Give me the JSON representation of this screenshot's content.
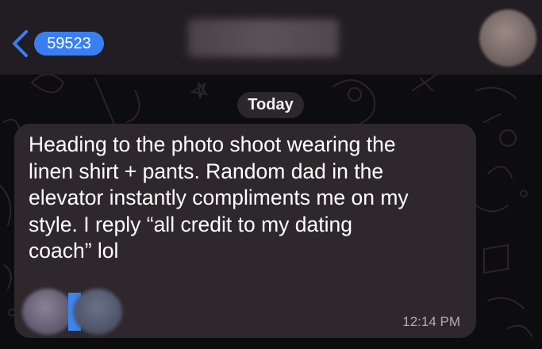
{
  "header": {
    "back_label": "Back",
    "unread_count": "59523",
    "colors": {
      "accent": "#3a7ff2",
      "bar": "#211d22"
    }
  },
  "chat": {
    "date_label": "Today",
    "message": {
      "text": "Heading to the photo shoot wearing the\nlinen shirt + pants. Random dad in the\nelevator instantly compliments me on my\nstyle. I reply “all credit to my dating\ncoach” lol",
      "time": "12:14 PM"
    },
    "icons": [
      "chevron-left-icon"
    ]
  }
}
